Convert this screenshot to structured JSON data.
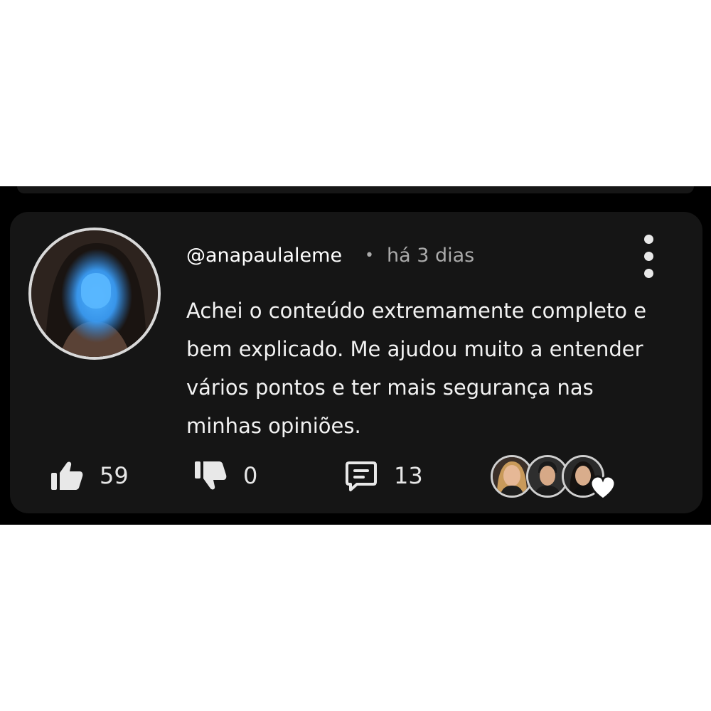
{
  "comment": {
    "author": "@anapaulaleme",
    "separator": "•",
    "timestamp": "há 3 dias",
    "text": "Achei o conteúdo extremamente completo e bem explicado. Me ajudou muito a entender vários pontos e ter mais segurança nas minhas opiniões."
  },
  "actions": {
    "likes": "59",
    "dislikes": "0",
    "replies": "13"
  },
  "icons": {
    "menu": "more-vertical-icon",
    "like": "thumbs-up-icon",
    "dislike": "thumbs-down-icon",
    "reply": "comment-icon",
    "heart": "heart-icon"
  },
  "colors": {
    "background": "#000000",
    "card": "#151515",
    "text": "#f2f2f2",
    "muted": "#aaaaaa",
    "avatar_blur": "#3aa0ff"
  }
}
